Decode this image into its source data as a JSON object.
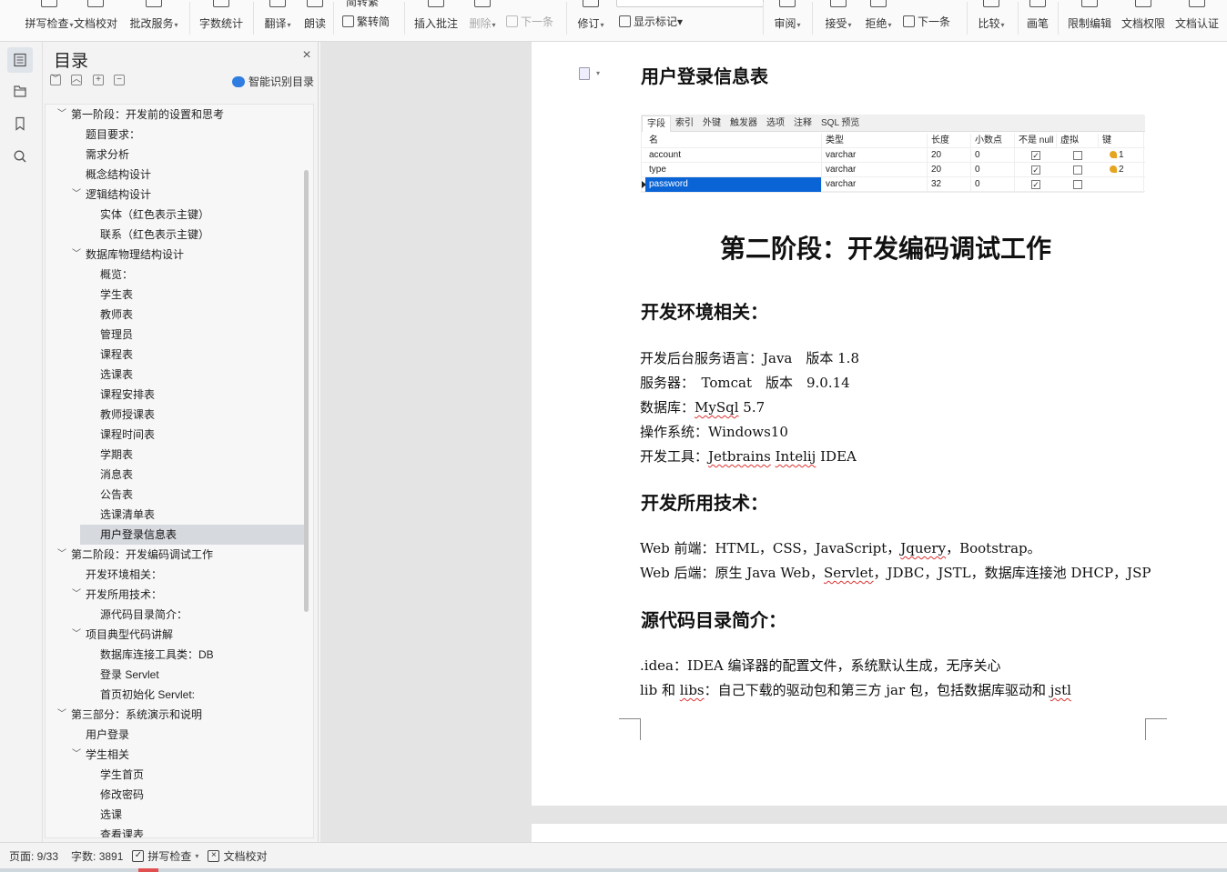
{
  "ribbon": {
    "buttons": [
      {
        "name": "spell-check-button",
        "label": "拼写检查",
        "caret": true
      },
      {
        "name": "doc-proofread-button",
        "label": "文档校对",
        "caret": false
      },
      {
        "name": "batch-service-button",
        "label": "批改服务",
        "caret": true
      },
      {
        "name": "word-count-button",
        "label": "字数统计",
        "caret": false
      },
      {
        "name": "translate-button",
        "label": "翻译",
        "caret": true
      },
      {
        "name": "read-aloud-button",
        "label": "朗读",
        "caret": false
      },
      {
        "name": "simp-trad-button",
        "label": "繁转简",
        "caret": false
      },
      {
        "name": "insert-comment-button",
        "label": "插入批注",
        "caret": false
      },
      {
        "name": "delete-comment-button",
        "label": "删除",
        "caret": true
      },
      {
        "name": "next-comment-button",
        "label": "下一条",
        "caret": false
      },
      {
        "name": "track-changes-button",
        "label": "修订",
        "caret": true
      },
      {
        "name": "show-markup-button",
        "label": "显示标记",
        "caret": true
      },
      {
        "name": "review-button",
        "label": "审阅",
        "caret": true
      },
      {
        "name": "accept-button",
        "label": "接受",
        "caret": true
      },
      {
        "name": "reject-button",
        "label": "拒绝",
        "caret": true
      },
      {
        "name": "next-change-button",
        "label": "下一条",
        "caret": false
      },
      {
        "name": "compare-button",
        "label": "比较",
        "caret": true
      },
      {
        "name": "pen-button",
        "label": "画笔",
        "caret": false
      },
      {
        "name": "restrict-edit-button",
        "label": "限制编辑",
        "caret": false
      },
      {
        "name": "doc-permission-button",
        "label": "文档权限",
        "caret": false
      },
      {
        "name": "doc-auth-button",
        "label": "文档认证",
        "caret": false
      }
    ],
    "simp_trad_top": "简转繁"
  },
  "toc": {
    "title": "目录",
    "smart_label": "智能识别目录",
    "items": [
      {
        "text": "第一阶段：开发前的设置和思考",
        "level": 1,
        "toggle": "﹀",
        "selected": false
      },
      {
        "text": "题目要求：",
        "level": 2,
        "toggle": "",
        "selected": false
      },
      {
        "text": "需求分析",
        "level": 2,
        "toggle": "",
        "selected": false
      },
      {
        "text": "概念结构设计",
        "level": 2,
        "toggle": "",
        "selected": false
      },
      {
        "text": "逻辑结构设计",
        "level": 2,
        "toggle": "﹀",
        "selected": false
      },
      {
        "text": "实体（红色表示主键）",
        "level": 3,
        "toggle": "",
        "selected": false
      },
      {
        "text": "联系（红色表示主键）",
        "level": 3,
        "toggle": "",
        "selected": false
      },
      {
        "text": "数据库物理结构设计",
        "level": 2,
        "toggle": "﹀",
        "selected": false
      },
      {
        "text": "概览：",
        "level": 3,
        "toggle": "",
        "selected": false
      },
      {
        "text": "学生表",
        "level": 3,
        "toggle": "",
        "selected": false
      },
      {
        "text": "教师表",
        "level": 3,
        "toggle": "",
        "selected": false
      },
      {
        "text": "管理员",
        "level": 3,
        "toggle": "",
        "selected": false
      },
      {
        "text": "课程表",
        "level": 3,
        "toggle": "",
        "selected": false
      },
      {
        "text": "选课表",
        "level": 3,
        "toggle": "",
        "selected": false
      },
      {
        "text": "课程安排表",
        "level": 3,
        "toggle": "",
        "selected": false
      },
      {
        "text": "教师授课表",
        "level": 3,
        "toggle": "",
        "selected": false
      },
      {
        "text": "课程时间表",
        "level": 3,
        "toggle": "",
        "selected": false
      },
      {
        "text": "学期表",
        "level": 3,
        "toggle": "",
        "selected": false
      },
      {
        "text": "消息表",
        "level": 3,
        "toggle": "",
        "selected": false
      },
      {
        "text": "公告表",
        "level": 3,
        "toggle": "",
        "selected": false
      },
      {
        "text": "选课清单表",
        "level": 3,
        "toggle": "",
        "selected": false
      },
      {
        "text": "用户登录信息表",
        "level": 3,
        "toggle": "",
        "selected": true
      },
      {
        "text": "第二阶段：开发编码调试工作",
        "level": 1,
        "toggle": "﹀",
        "selected": false
      },
      {
        "text": "开发环境相关：",
        "level": 2,
        "toggle": "",
        "selected": false
      },
      {
        "text": "开发所用技术：",
        "level": 2,
        "toggle": "﹀",
        "selected": false
      },
      {
        "text": "源代码目录简介：",
        "level": 3,
        "toggle": "",
        "selected": false
      },
      {
        "text": "项目典型代码讲解",
        "level": 2,
        "toggle": "﹀",
        "selected": false
      },
      {
        "text": "数据库连接工具类：DB",
        "level": 3,
        "toggle": "",
        "selected": false
      },
      {
        "text": "登录 Servlet",
        "level": 3,
        "toggle": "",
        "selected": false
      },
      {
        "text": "首页初始化 Servlet:",
        "level": 3,
        "toggle": "",
        "selected": false
      },
      {
        "text": "第三部分：系统演示和说明",
        "level": 1,
        "toggle": "﹀",
        "selected": false
      },
      {
        "text": "用户登录",
        "level": 2,
        "toggle": "",
        "selected": false
      },
      {
        "text": "学生相关",
        "level": 2,
        "toggle": "﹀",
        "selected": false
      },
      {
        "text": "学生首页",
        "level": 3,
        "toggle": "",
        "selected": false
      },
      {
        "text": "修改密码",
        "level": 3,
        "toggle": "",
        "selected": false
      },
      {
        "text": "选课",
        "level": 3,
        "toggle": "",
        "selected": false
      },
      {
        "text": "查看课表",
        "level": 3,
        "toggle": "",
        "selected": false
      }
    ]
  },
  "doc": {
    "heading_login_table": "用户登录信息表",
    "db_table": {
      "tabs": [
        "字段",
        "索引",
        "外键",
        "触发器",
        "选项",
        "注释",
        "SQL 预览"
      ],
      "headers": [
        "名",
        "类型",
        "长度",
        "小数点",
        "不是 null",
        "虚拟",
        "键"
      ],
      "rows": [
        {
          "name": "account",
          "type": "varchar",
          "length": "20",
          "decimals": "0",
          "not_null": true,
          "virtual": false,
          "key": "1"
        },
        {
          "name": "type",
          "type": "varchar",
          "length": "20",
          "decimals": "0",
          "not_null": true,
          "virtual": false,
          "key": "2"
        },
        {
          "name": "password",
          "type": "varchar",
          "length": "32",
          "decimals": "0",
          "not_null": true,
          "virtual": false,
          "key": ""
        }
      ]
    },
    "stage2_title": "第二阶段：开发编码调试工作",
    "env_heading": "开发环境相关：",
    "env_lines": [
      [
        "开发后台服务语言：Java　版本 1.8"
      ],
      [
        "服务器：　Tomcat　版本　9.0.14"
      ],
      [
        "数据库：",
        "MySql",
        " 5.7"
      ],
      [
        "操作系统：Windows10"
      ],
      [
        "开发工具：",
        "Jetbrains",
        " ",
        "Intelij",
        " IDEA"
      ]
    ],
    "tech_heading": "开发所用技术：",
    "tech_lines": [
      [
        "Web 前端：HTML，CSS，JavaScript，",
        "Jquery",
        "，Bootstrap。"
      ],
      [
        "Web 后端：原生 Java Web，",
        "Servlet",
        "，JDBC，JSTL，数据库连接池 DHCP，JSP"
      ]
    ],
    "src_heading": "源代码目录简介：",
    "src_lines": [
      [
        ".idea：IDEA 编译器的配置文件，系统默认生成，无序关心"
      ],
      [
        "lib 和 ",
        "libs",
        "：自己下载的驱动包和第三方 jar 包，包括数据库驱动和 ",
        "jstl"
      ]
    ]
  },
  "status": {
    "page": "页面: 9/33",
    "words": "字数: 3891",
    "spell": "拼写检查",
    "proof": "文档校对"
  }
}
